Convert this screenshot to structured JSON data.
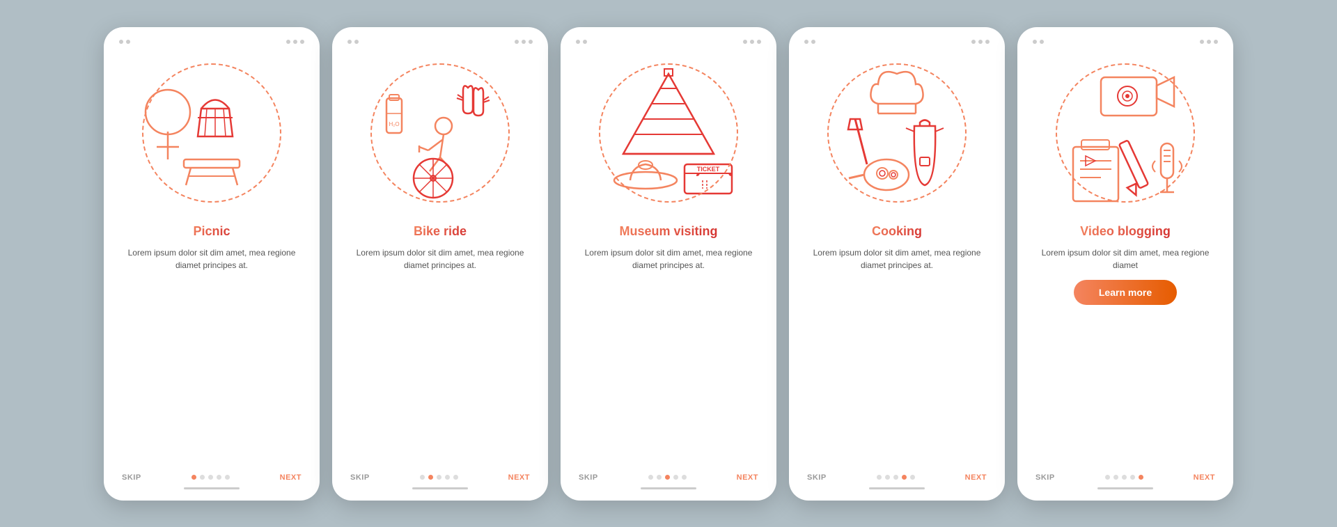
{
  "cards": [
    {
      "id": "picnic",
      "title": "Picnic",
      "description": "Lorem ipsum dolor sit dim amet, mea regione diamet principes at.",
      "active_dot": 0,
      "show_button": false,
      "dots": [
        0,
        1,
        2,
        3,
        4
      ]
    },
    {
      "id": "bike-ride",
      "title": "Bike ride",
      "description": "Lorem ipsum dolor sit dim amet, mea regione diamet principes at.",
      "active_dot": 1,
      "show_button": false,
      "dots": [
        0,
        1,
        2,
        3,
        4
      ]
    },
    {
      "id": "museum-visiting",
      "title": "Museum visiting",
      "description": "Lorem ipsum dolor sit dim amet, mea regione diamet principes at.",
      "active_dot": 2,
      "show_button": false,
      "dots": [
        0,
        1,
        2,
        3,
        4
      ]
    },
    {
      "id": "cooking",
      "title": "Cooking",
      "description": "Lorem ipsum dolor sit dim amet, mea regione diamet principes at.",
      "active_dot": 3,
      "show_button": false,
      "dots": [
        0,
        1,
        2,
        3,
        4
      ]
    },
    {
      "id": "video-blogging",
      "title": "Video blogging",
      "description": "Lorem ipsum dolor sit dim amet, mea regione diamet",
      "active_dot": 4,
      "show_button": true,
      "learn_more_label": "Learn more",
      "dots": [
        0,
        1,
        2,
        3,
        4
      ]
    }
  ],
  "nav": {
    "skip_label": "SKIP",
    "next_label": "NEXT"
  }
}
